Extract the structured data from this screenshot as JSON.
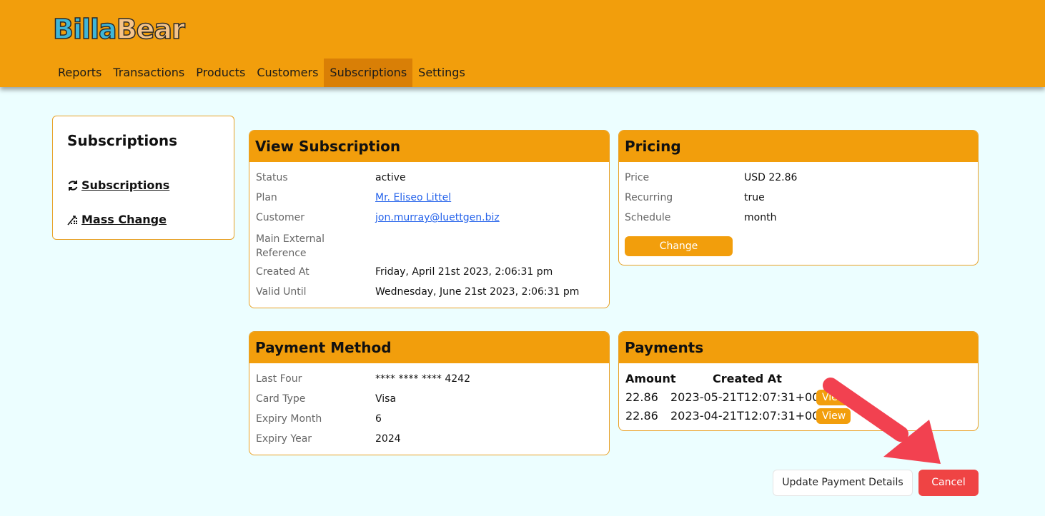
{
  "brand": {
    "logo_part1": "Billa",
    "logo_part2": "Bear"
  },
  "nav": {
    "items": [
      {
        "label": "Reports"
      },
      {
        "label": "Transactions"
      },
      {
        "label": "Products"
      },
      {
        "label": "Customers"
      },
      {
        "label": "Subscriptions",
        "active": true
      },
      {
        "label": "Settings"
      }
    ]
  },
  "sidebar": {
    "title": "Subscriptions",
    "links": [
      {
        "label": "Subscriptions",
        "icon": "refresh-icon"
      },
      {
        "label": "Mass Change",
        "icon": "mass-change-icon"
      }
    ]
  },
  "subscription": {
    "title": "View Subscription",
    "fields": [
      {
        "label": "Status",
        "value": "active"
      },
      {
        "label": "Plan",
        "value": "Mr. Eliseo Littel"
      },
      {
        "label": "Customer",
        "value": "jon.murray@luettgen.biz"
      },
      {
        "label": "Main External Reference",
        "value": ""
      },
      {
        "label": "Created At",
        "value": "Friday, April 21st 2023, 2:06:31 pm"
      },
      {
        "label": "Valid Until",
        "value": "Wednesday, June 21st 2023, 2:06:31 pm"
      }
    ]
  },
  "pricing": {
    "title": "Pricing",
    "fields": [
      {
        "label": "Price",
        "value": "USD 22.86"
      },
      {
        "label": "Recurring",
        "value": "true"
      },
      {
        "label": "Schedule",
        "value": "month"
      }
    ],
    "change_label": "Change"
  },
  "payment_method": {
    "title": "Payment Method",
    "fields": [
      {
        "label": "Last Four",
        "value": "**** **** **** 4242"
      },
      {
        "label": "Card Type",
        "value": "Visa"
      },
      {
        "label": "Expiry Month",
        "value": "6"
      },
      {
        "label": "Expiry Year",
        "value": "2024"
      }
    ]
  },
  "payments": {
    "title": "Payments",
    "headers": [
      "Amount",
      "Created At"
    ],
    "rows": [
      {
        "amount": "22.86",
        "created_at": "2023-05-21T12:07:31+00:00",
        "action": "View"
      },
      {
        "amount": "22.86",
        "created_at": "2023-04-21T12:07:31+00:00",
        "action": "View"
      }
    ]
  },
  "actions": {
    "update_payment_label": "Update Payment Details",
    "cancel_label": "Cancel"
  },
  "colors": {
    "header": "#f29e0c",
    "accent": "#f29e0c",
    "danger": "#ef4444",
    "page_bg": "#ecfeff",
    "annotation_arrow": "#f24150"
  }
}
